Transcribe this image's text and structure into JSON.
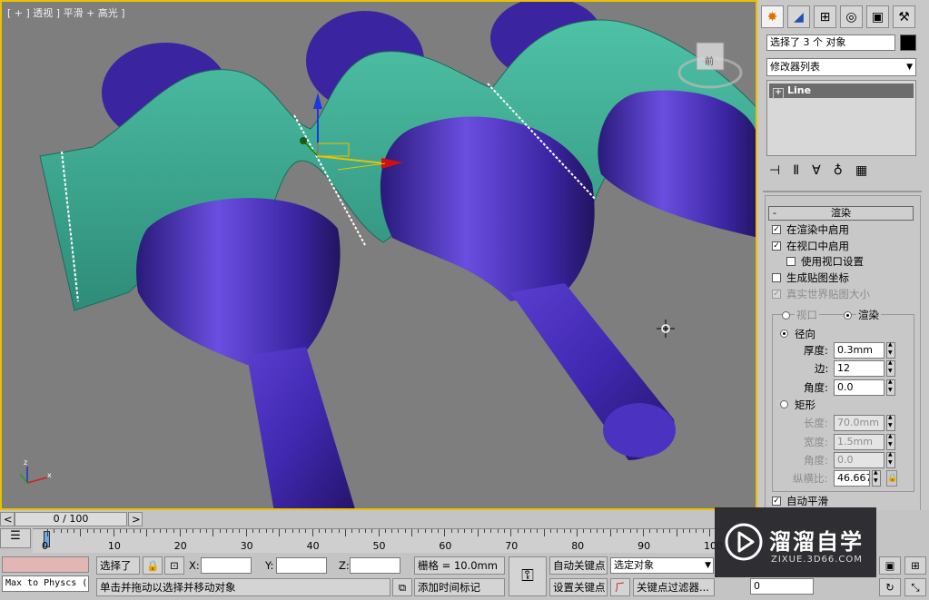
{
  "viewport": {
    "label": "[ + ] 透视 ] 平滑 + 高光 ]",
    "viewcube_face": "前"
  },
  "panel": {
    "tabs": [
      "create-icon",
      "modify-icon",
      "hierarchy-icon",
      "motion-icon",
      "display-icon",
      "utilities-icon"
    ],
    "selection_text": "选择了 3 个 对象",
    "modifier_list": "修改器列表",
    "stack_item": "Line",
    "stack_toggle": "+",
    "rollout_title": "渲染",
    "rollout_toggle": "-",
    "enable_in_renderer": "在渲染中启用",
    "enable_in_viewport": "在视口中启用",
    "use_viewport_settings": "使用视口设置",
    "generate_mapping": "生成贴图坐标",
    "real_world_map": "真实世界贴图大小",
    "viewport_radio": "视口",
    "render_radio": "渲染",
    "radial": "径向",
    "thickness_label": "厚度:",
    "thickness_value": "0.3mm",
    "sides_label": "边:",
    "sides_value": "12",
    "angle_label": "角度:",
    "angle_value": "0.0",
    "rectangular": "矩形",
    "length_label": "长度:",
    "length_value": "70.0mm",
    "width_label": "宽度:",
    "width_value": "1.5mm",
    "angle2_label": "角度:",
    "angle2_value": "0.0",
    "aspect_label": "纵横比:",
    "aspect_value": "46.667",
    "auto_smooth": "自动平滑"
  },
  "timeline": {
    "slider_text": "0 / 100",
    "prev": "<",
    "next": ">",
    "ticks": [
      "0",
      "10",
      "20",
      "30",
      "40",
      "50",
      "60",
      "70",
      "80",
      "90",
      "100"
    ]
  },
  "status": {
    "maxscript": "Max to Physcs (",
    "selected": "选择了",
    "x_label": "X:",
    "y_label": "Y:",
    "z_label": "Z:",
    "grid": "栅格 = 10.0mm",
    "prompt": "单击并拖动以选择并移动对象",
    "add_time_tag": "添加时间标记",
    "auto_key": "自动关键点",
    "set_key": "设置关键点",
    "selected_object": "选定对象",
    "key_filters": "关键点过滤器...",
    "frame_value": "0"
  },
  "watermark": {
    "title": "溜溜自学",
    "url": "ZIXUE.3D66.COM"
  },
  "colors": {
    "viewport_bg": "#7e7e7e",
    "active_border": "#e8c200",
    "teal": "#3aa08a",
    "purple": "#4a2fb0"
  }
}
